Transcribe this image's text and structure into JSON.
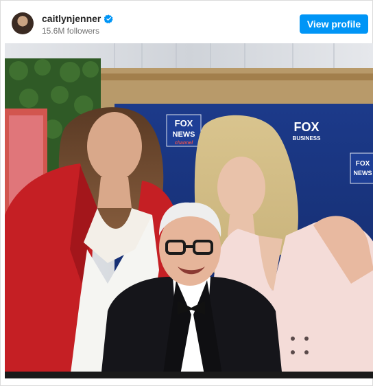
{
  "post": {
    "username": "caitlynjenner",
    "followers": "15.6M followers",
    "view_profile": "View profile",
    "verified_icon": "verified-badge-icon",
    "colors": {
      "accent": "#0095f6",
      "verified": "#0095f6"
    }
  },
  "photo": {
    "backdrop_logos": {
      "fox_news_top": "FOX",
      "news_top": "NEWS",
      "channel": "channel",
      "fox_business": "FOX",
      "business": "BUSINESS",
      "fox_news_right": "FOX",
      "news_right": "NEWS"
    }
  }
}
